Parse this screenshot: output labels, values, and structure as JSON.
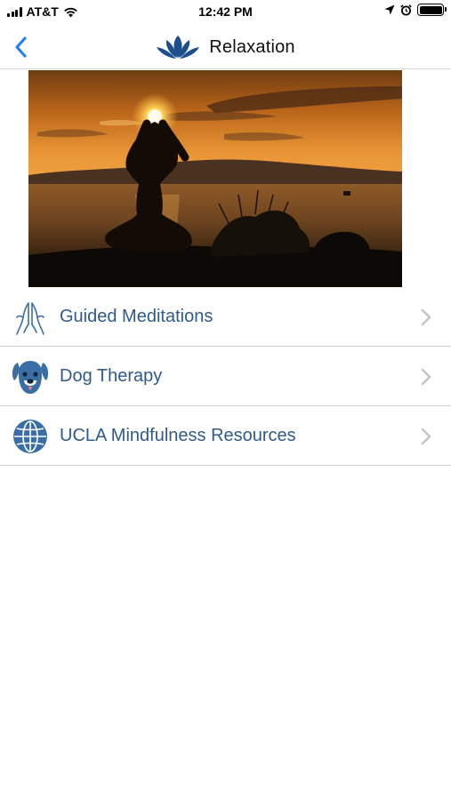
{
  "status_bar": {
    "carrier": "AT&T",
    "time": "12:42 PM"
  },
  "nav": {
    "title": "Relaxation",
    "back_icon": "chevron-left-icon",
    "logo_icon": "lotus-icon"
  },
  "hero": {
    "icon": "yoga-sunset-photo"
  },
  "list": {
    "items": [
      {
        "label": "Guided Meditations",
        "icon": "praying-hands-icon"
      },
      {
        "label": "Dog Therapy",
        "icon": "dog-icon"
      },
      {
        "label": "UCLA Mindfulness Resources",
        "icon": "globe-icon"
      }
    ]
  },
  "colors": {
    "accent": "#2f5a8c",
    "back_blue": "#1a7ef2",
    "icon_blue": "#3a6fa5"
  }
}
